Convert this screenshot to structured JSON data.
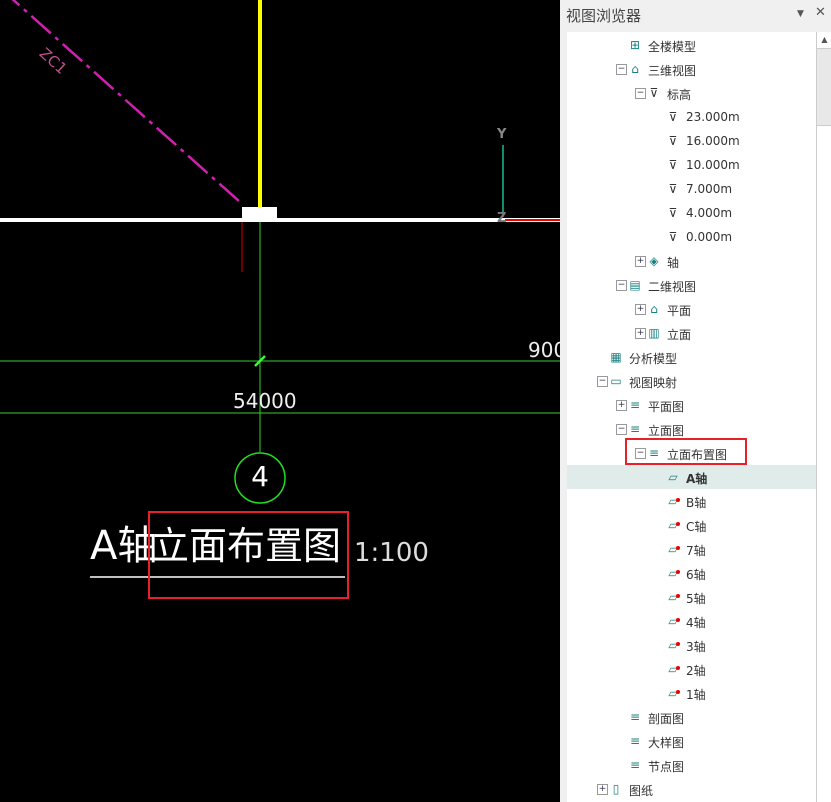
{
  "canvas": {
    "zc_label": "ZC1",
    "axis_y": "Y",
    "axis_z": "Z",
    "dim_main": "54000",
    "dim_right": "900",
    "grid_bubble": "4",
    "title_prefix": "A轴",
    "title_main": "立面布置图",
    "scale": "1:100"
  },
  "panel": {
    "title": "视图浏览器",
    "dropdown_icon": "▼",
    "close_icon": "✕",
    "tree": [
      {
        "level": 1,
        "toggle": "",
        "icon": "building-model",
        "label": "全楼模型"
      },
      {
        "level": 1,
        "toggle": "-",
        "icon": "3d-view",
        "label": "三维视图"
      },
      {
        "level": 2,
        "toggle": "-",
        "icon": "elevation-mark",
        "label": "标高"
      },
      {
        "level": 3,
        "toggle": "",
        "icon": "elevation-mark",
        "label": "23.000m"
      },
      {
        "level": 3,
        "toggle": "",
        "icon": "elevation-mark",
        "label": "16.000m"
      },
      {
        "level": 3,
        "toggle": "",
        "icon": "elevation-mark",
        "label": "10.000m"
      },
      {
        "level": 3,
        "toggle": "",
        "icon": "elevation-mark",
        "label": "7.000m"
      },
      {
        "level": 3,
        "toggle": "",
        "icon": "elevation-mark",
        "label": "4.000m"
      },
      {
        "level": 3,
        "toggle": "",
        "icon": "elevation-mark",
        "label": "0.000m"
      },
      {
        "level": 2,
        "toggle": "+",
        "icon": "axis",
        "label": "轴"
      },
      {
        "level": 1,
        "toggle": "-",
        "icon": "2d-view",
        "label": "二维视图"
      },
      {
        "level": 2,
        "toggle": "+",
        "icon": "plan",
        "label": "平面"
      },
      {
        "level": 2,
        "toggle": "+",
        "icon": "elevation",
        "label": "立面"
      },
      {
        "level": 0,
        "toggle": "",
        "icon": "analysis-model",
        "label": "分析模型"
      },
      {
        "level": 0,
        "toggle": "-",
        "icon": "folder",
        "label": "视图映射"
      },
      {
        "level": 1,
        "toggle": "+",
        "icon": "layers",
        "label": "平面图"
      },
      {
        "level": 1,
        "toggle": "-",
        "icon": "layers",
        "label": "立面图"
      },
      {
        "level": 2,
        "toggle": "-",
        "icon": "layers",
        "label": "立面布置图",
        "boxed": true
      },
      {
        "level": 3,
        "toggle": "",
        "icon": "sheet",
        "label": "A轴",
        "selected": true
      },
      {
        "level": 3,
        "toggle": "",
        "icon": "sheet-marked",
        "label": "B轴"
      },
      {
        "level": 3,
        "toggle": "",
        "icon": "sheet-marked",
        "label": "C轴"
      },
      {
        "level": 3,
        "toggle": "",
        "icon": "sheet-marked",
        "label": "7轴"
      },
      {
        "level": 3,
        "toggle": "",
        "icon": "sheet-marked",
        "label": "6轴"
      },
      {
        "level": 3,
        "toggle": "",
        "icon": "sheet-marked",
        "label": "5轴"
      },
      {
        "level": 3,
        "toggle": "",
        "icon": "sheet-marked",
        "label": "4轴"
      },
      {
        "level": 3,
        "toggle": "",
        "icon": "sheet-marked",
        "label": "3轴"
      },
      {
        "level": 3,
        "toggle": "",
        "icon": "sheet-marked",
        "label": "2轴"
      },
      {
        "level": 3,
        "toggle": "",
        "icon": "sheet-marked",
        "label": "1轴"
      },
      {
        "level": 1,
        "toggle": "",
        "icon": "layers",
        "label": "剖面图"
      },
      {
        "level": 1,
        "toggle": "",
        "icon": "layers",
        "label": "大样图"
      },
      {
        "level": 1,
        "toggle": "",
        "icon": "layers",
        "label": "节点图"
      },
      {
        "level": 0,
        "toggle": "+",
        "icon": "drawing",
        "label": "图纸"
      }
    ]
  }
}
